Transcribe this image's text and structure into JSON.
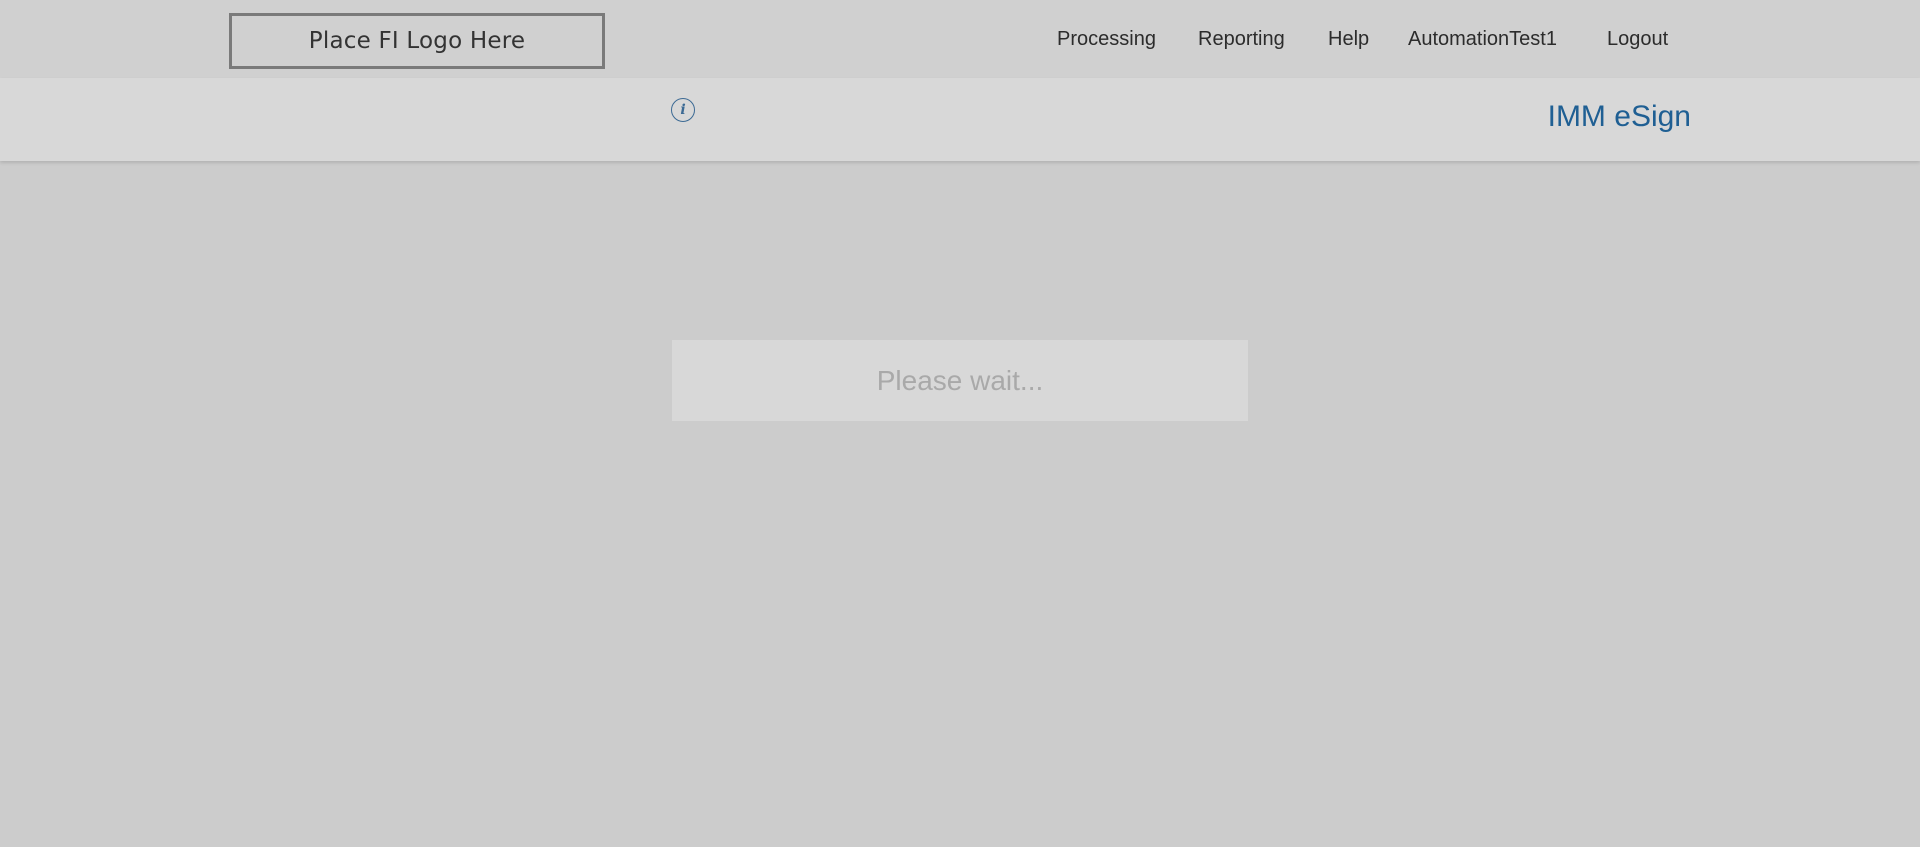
{
  "header": {
    "logo_text": "Place FI Logo Here",
    "nav": [
      {
        "label": "Processing"
      },
      {
        "label": "Reporting"
      },
      {
        "label": "Help"
      },
      {
        "label": "AutomationTest1"
      },
      {
        "label": "Logout"
      }
    ]
  },
  "subheader": {
    "info_icon": "info-icon",
    "info_glyph": "i",
    "app_title": "IMM eSign"
  },
  "main": {
    "loading_text": "Please wait..."
  },
  "colors": {
    "background": "#cccccc",
    "topbar": "#d0d0d0",
    "subbar": "#d8d8d8",
    "brand_blue": "#1f5f93",
    "loading_text": "#a9a9a9"
  }
}
